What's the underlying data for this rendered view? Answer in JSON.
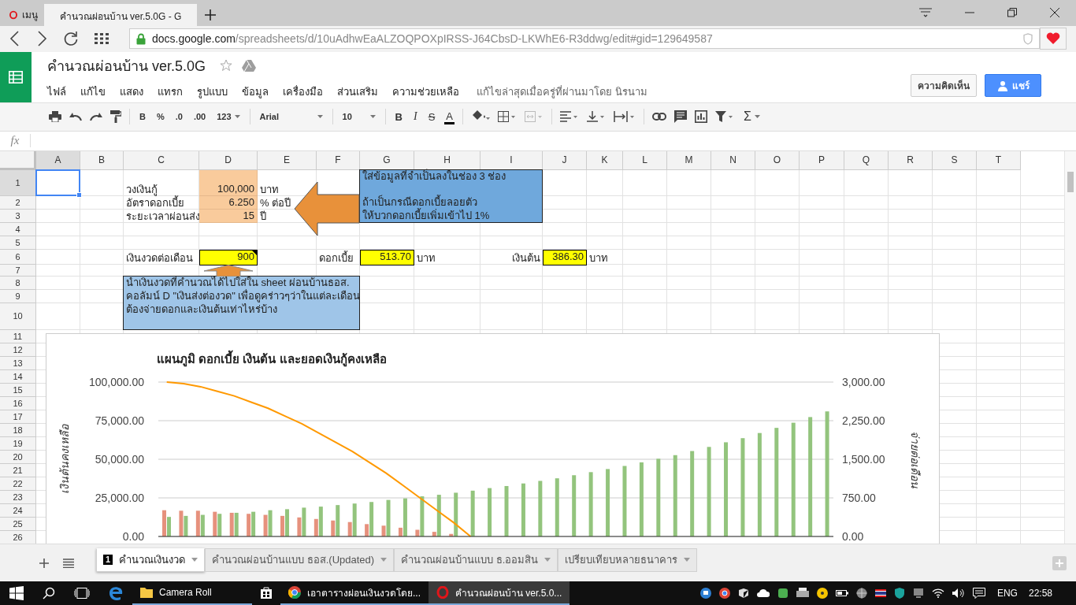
{
  "browser": {
    "tabs": [
      {
        "label": "เมนู",
        "kind": "menu",
        "selected": false
      },
      {
        "label": "คำนวณผ่อนบ้าน ver.5.0G - G",
        "kind": "page",
        "selected": true
      }
    ],
    "url_host": "docs.google.com",
    "url_path": "/spreadsheets/d/10uAdhwEaALZOQPOXpIRSS-J64CbsD-LKWhE6-R3ddwg/edit#gid=129649587"
  },
  "doc": {
    "title": "คำนวณผ่อนบ้าน ver.5.0G",
    "menu": [
      "ไฟล์",
      "แก้ไข",
      "แสดง",
      "แทรก",
      "รูปแบบ",
      "ข้อมูล",
      "เครื่องมือ",
      "ส่วนเสริม",
      "ความช่วยเหลือ"
    ],
    "last_edit": "แก้ไขล่าสุดเมื่อครู่ที่ผ่านมาโดย นิรนาม",
    "comments_button": "ความคิดเห็น",
    "share_button": "แชร์"
  },
  "toolbar": {
    "number_buttons": [
      "B",
      "%",
      ".0",
      ".00"
    ],
    "number_format": "123",
    "font": "Arial",
    "font_size": "10",
    "style_buttons": [
      "B",
      "I",
      "S",
      "A"
    ],
    "sum": "Σ"
  },
  "formula_bar": {
    "label": "fx"
  },
  "grid": {
    "columns": [
      {
        "label": "A",
        "selected": true
      },
      {
        "label": "B",
        "selected": false
      },
      {
        "label": "C",
        "selected": false
      },
      {
        "label": "D",
        "selected": false
      },
      {
        "label": "E",
        "selected": false
      },
      {
        "label": "F",
        "selected": false
      },
      {
        "label": "G",
        "selected": false
      },
      {
        "label": "H",
        "selected": false
      },
      {
        "label": "I",
        "selected": false
      },
      {
        "label": "J",
        "selected": false
      },
      {
        "label": "K",
        "selected": false
      },
      {
        "label": "L",
        "selected": false
      },
      {
        "label": "M",
        "selected": false
      },
      {
        "label": "N",
        "selected": false
      },
      {
        "label": "O",
        "selected": false
      },
      {
        "label": "P",
        "selected": false
      },
      {
        "label": "Q",
        "selected": false
      },
      {
        "label": "R",
        "selected": false
      },
      {
        "label": "S",
        "selected": false
      },
      {
        "label": "T",
        "selected": false
      }
    ],
    "rows": [
      {
        "label": "1",
        "selected": true,
        "cells": [
          null,
          null,
          {
            "text": "วงเงินกู้",
            "kind": "label"
          },
          {
            "text": "100,000",
            "kind": "input"
          },
          {
            "text": "บาท",
            "kind": "label"
          },
          null,
          {
            "text": "ใส่ข้อมูลที่จำเป็นลงในช่อง 3 ช่อง",
            "kind": "note",
            "color": "#6fa8dc"
          },
          {
            "kind": "note",
            "color": "#6fa8dc"
          },
          {
            "kind": "note",
            "color": "#6fa8dc"
          }
        ]
      },
      {
        "label": "2",
        "selected": false,
        "cells": [
          null,
          null,
          {
            "text": "อัตราดอกเบี้ย",
            "kind": "label"
          },
          {
            "text": "6.250",
            "kind": "input"
          },
          {
            "text": "% ต่อปี",
            "kind": "label"
          },
          null,
          {
            "text": "ถ้าเป็นกรณีดอกเบี้ยลอยตัว",
            "kind": "note",
            "color": "#6fa8dc"
          },
          {
            "kind": "note",
            "color": "#6fa8dc"
          },
          {
            "kind": "note",
            "color": "#6fa8dc"
          }
        ]
      },
      {
        "label": "3",
        "selected": false,
        "cells": [
          null,
          null,
          {
            "text": "ระยะเวลาผ่อนส่ง",
            "kind": "label"
          },
          {
            "text": "15",
            "kind": "input"
          },
          {
            "text": "ปี",
            "kind": "label"
          },
          null,
          {
            "text": "ให้บวกดอกเบี้ยเพิ่มเข้าไป 1%",
            "kind": "note",
            "color": "#6fa8dc"
          },
          {
            "kind": "note",
            "color": "#6fa8dc"
          },
          {
            "kind": "note",
            "color": "#6fa8dc"
          }
        ]
      },
      {
        "label": "4",
        "selected": false
      },
      {
        "label": "5",
        "selected": false
      },
      {
        "label": "6",
        "selected": false,
        "cells": [
          null,
          null,
          {
            "text": "เงินงวดต่อเดือน",
            "kind": "label"
          },
          {
            "text": "900",
            "kind": "output",
            "has_note": true
          },
          null,
          {
            "text": "ดอกเบี้ย",
            "kind": "label"
          },
          {
            "text": "513.70",
            "kind": "output",
            "has_note": false
          },
          {
            "text": "บาท",
            "kind": "label"
          },
          {
            "text": "เงินต้น",
            "kind": "label-right"
          },
          {
            "text": "386.30",
            "kind": "output",
            "has_note": false
          },
          {
            "text": "บาท",
            "kind": "label"
          }
        ]
      },
      {
        "label": "7",
        "selected": false
      },
      {
        "label": "8",
        "selected": false,
        "cells": [
          null,
          null,
          {
            "text": "นำเงินงวดที่คำนวณได้ไปใส่ใน sheet ผ่อนบ้านธอส.",
            "kind": "note",
            "color": "#9fc5e8"
          },
          {
            "kind": "note",
            "color": "#9fc5e8"
          },
          {
            "kind": "note",
            "color": "#9fc5e8"
          },
          {
            "kind": "note",
            "color": "#9fc5e8"
          }
        ]
      },
      {
        "label": "9",
        "selected": false,
        "cells": [
          null,
          null,
          {
            "text": "คอลัมน์ D \"เงินส่งต่องวด\" เพื่อดูคร่าวๆว่าในแต่ละเดือน",
            "kind": "note",
            "color": "#9fc5e8"
          },
          {
            "kind": "note",
            "color": "#9fc5e8"
          },
          {
            "kind": "note",
            "color": "#9fc5e8"
          },
          {
            "kind": "note",
            "color": "#9fc5e8"
          }
        ]
      },
      {
        "label": "10",
        "selected": false,
        "cells": [
          null,
          null,
          {
            "text": "ต้องจ่ายดอกและเงินต้นเท่าไหร่บ้าง",
            "kind": "note",
            "color": "#9fc5e8"
          },
          {
            "kind": "note",
            "color": "#9fc5e8"
          },
          {
            "kind": "note",
            "color": "#9fc5e8"
          },
          {
            "kind": "note",
            "color": "#9fc5e8"
          }
        ]
      },
      {
        "label": "11",
        "selected": false
      },
      {
        "label": "12",
        "selected": false
      },
      {
        "label": "13",
        "selected": false
      },
      {
        "label": "14",
        "selected": false
      },
      {
        "label": "15",
        "selected": false
      },
      {
        "label": "16",
        "selected": false
      },
      {
        "label": "17",
        "selected": false
      },
      {
        "label": "18",
        "selected": false
      },
      {
        "label": "19",
        "selected": false
      },
      {
        "label": "20",
        "selected": false
      },
      {
        "label": "21",
        "selected": false
      },
      {
        "label": "22",
        "selected": false
      },
      {
        "label": "23",
        "selected": false
      },
      {
        "label": "24",
        "selected": false
      },
      {
        "label": "25",
        "selected": false
      },
      {
        "label": "26",
        "selected": false
      }
    ]
  },
  "chart": {
    "chart_data": {
      "type": "bar",
      "title": "แผนภูมิ ดอกเบี้ย เงินต้น และยอดเงินกู้คงเหลือ",
      "ylabel": "เงินต้นคงเหลือ",
      "y2label": "จ่ายต่อเดือน",
      "stacked": false,
      "grid": true,
      "ylim": [
        0,
        100000
      ],
      "yticks": [
        {
          "value": 0,
          "label": "0.00"
        },
        {
          "value": 25000,
          "label": "25,000.00"
        },
        {
          "value": 50000,
          "label": "50,000.00"
        },
        {
          "value": 75000,
          "label": "75,000.00"
        },
        {
          "value": 100000,
          "label": "100,000.00"
        }
      ],
      "y2lim": [
        0,
        3000
      ],
      "y2ticks": [
        {
          "value": 0,
          "label": "0.00"
        },
        {
          "value": 750,
          "label": "750.00"
        },
        {
          "value": 1500,
          "label": "1,500.00"
        },
        {
          "value": 2250,
          "label": "2,250.00"
        },
        {
          "value": 3000,
          "label": "3,000.00"
        }
      ],
      "series": [
        {
          "type": "bar",
          "axis": "y2",
          "color": "#e6917d",
          "values": [
            510,
            500,
            500,
            480,
            460,
            440,
            420,
            400,
            370,
            340,
            310,
            280,
            240,
            210,
            170,
            130,
            90,
            50,
            0,
            null,
            null,
            null,
            null,
            null,
            null,
            null,
            null,
            null,
            null,
            null,
            null,
            null,
            null,
            null,
            null,
            null,
            null,
            null,
            null,
            null
          ]
        },
        {
          "type": "bar",
          "axis": "y2",
          "color": "#93c47d",
          "values": [
            380,
            400,
            420,
            440,
            460,
            480,
            510,
            530,
            560,
            580,
            610,
            640,
            670,
            710,
            740,
            780,
            810,
            850,
            890,
            940,
            980,
            1030,
            1080,
            1130,
            1190,
            1250,
            1310,
            1370,
            1440,
            1510,
            1580,
            1660,
            1740,
            1830,
            1910,
            2010,
            2110,
            2210,
            2320,
            2430
          ]
        },
        {
          "type": "line",
          "color": "#ff9900",
          "values": [
            100000,
            99000,
            97000,
            94000,
            91000,
            87000,
            83000,
            78000,
            73000,
            67000,
            61000,
            55000,
            48000,
            41000,
            33000,
            25000,
            17000,
            9000,
            0,
            null,
            null,
            null,
            null,
            null,
            null,
            null,
            null,
            null,
            null,
            null,
            null,
            null,
            null,
            null,
            null,
            null,
            null,
            null,
            null,
            null
          ]
        }
      ]
    }
  },
  "sheet_tabs": [
    {
      "label": "คำนวณเงินงวด",
      "badge": "1",
      "selected": true
    },
    {
      "label": "คำนวณผ่อนบ้านแบบ ธอส.(Updated)",
      "selected": false
    },
    {
      "label": "คำนวณผ่อนบ้านแบบ ธ.ออมสิน",
      "selected": false
    },
    {
      "label": "เปรียบเทียบหลายธนาคาร",
      "selected": false
    }
  ],
  "taskbar": {
    "apps": [
      {
        "kind": "folder",
        "label": "Camera Roll",
        "active": false
      },
      {
        "kind": "store",
        "active": false
      },
      {
        "kind": "globe",
        "label": "เอาตารางผ่อนเงินงวดโดย...",
        "active": false
      },
      {
        "kind": "ring",
        "label": "คำนวณผ่อนบ้าน ver.5.0...",
        "active": true
      }
    ],
    "language": "ENG",
    "time": "22:58"
  }
}
